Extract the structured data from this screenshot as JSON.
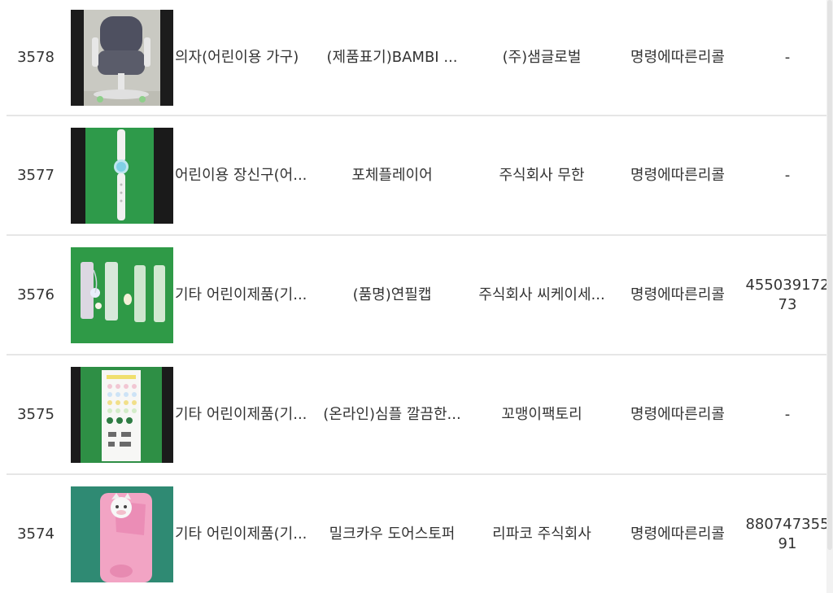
{
  "rows": [
    {
      "number": "3578",
      "thumbnail": "child-chair-photo",
      "category": "의자(어린이용 가구)",
      "product": "(제품표기)BAMBI ...",
      "company": "(주)샘글로벌",
      "action": "명령에따른리콜",
      "barcode": "-"
    },
    {
      "number": "3577",
      "thumbnail": "kids-watch-photo",
      "category": "어린이용 장신구(어...",
      "product": "포체플레이어",
      "company": "주식회사 무한",
      "action": "명령에따른리콜",
      "barcode": "-"
    },
    {
      "number": "3576",
      "thumbnail": "pencil-caps-photo",
      "category": "기타 어린이제품(기...",
      "product": "(품명)연필캡",
      "company": "주식회사 씨케이세...",
      "action": "명령에따른리콜",
      "barcode": "455039172 73"
    },
    {
      "number": "3575",
      "thumbnail": "sticker-sheet-photo",
      "category": "기타 어린이제품(기...",
      "product": "(온라인)심플 깔끔한...",
      "company": "꼬맹이팩토리",
      "action": "명령에따른리콜",
      "barcode": "-"
    },
    {
      "number": "3574",
      "thumbnail": "milk-cow-doorstopper-photo",
      "category": "기타 어린이제품(기...",
      "product": "밀크카우 도어스토퍼",
      "company": "리파코 주식회사",
      "action": "명령에따른리콜",
      "barcode": "880747355 91"
    }
  ],
  "colors": {
    "text": "#333333",
    "divider": "#e6e6e6",
    "photo_green_bg": "#2e9a4a",
    "photo_black_bg": "#1a1a1a"
  }
}
